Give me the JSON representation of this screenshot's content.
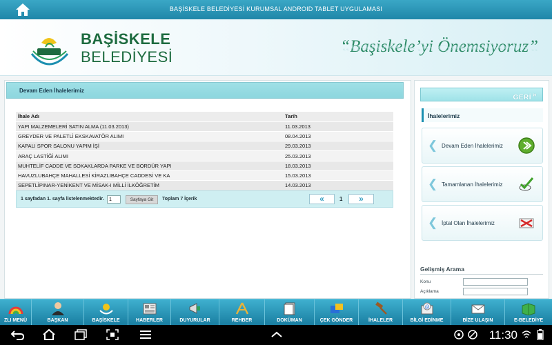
{
  "app_title": "BAŞİSKELE BELEDİYESİ KURUMSAL ANDROID TABLET UYGULAMASI",
  "logo": {
    "line1": "BAŞİSKELE",
    "line2": "BELEDİYESİ",
    "emblem_text": "BAŞİSKELE BELEDİYESİ"
  },
  "slogan": "“Başiskele’yi Önemsiyoruz”",
  "content": {
    "heading": "Devam Eden İhalelerimiz",
    "columns": [
      "İhale Adı",
      "Tarih"
    ],
    "rows": [
      {
        "name": "YAPI MALZEMELERİ SATIN ALMA (11.03.2013)",
        "date": "11.03.2013"
      },
      {
        "name": "GREYDER VE PALETLİ EKSKAVATÖR ALIMI",
        "date": "08.04.2013"
      },
      {
        "name": "KAPALI SPOR SALONU YAPIM İŞİ",
        "date": "29.03.2013"
      },
      {
        "name": "ARAÇ LASTİĞİ ALIMI",
        "date": "25.03.2013"
      },
      {
        "name": "MUHTELİF CADDE VE SOKAKLARDA PARKE VE BORDÜR YAPI",
        "date": "18.03.2013"
      },
      {
        "name": "HAVUZLUBAHÇE MAHALLESİ KİRAZLIBAHÇE CADDESİ VE KA",
        "date": "15.03.2013"
      },
      {
        "name": "SEPETLİPINAR-YENİKENT VE MİSAK-I MİLLİ İLKÖĞRETİM",
        "date": "14.03.2013"
      }
    ],
    "pager": {
      "status": "1 sayfadan 1. sayfa listelenmektedir.",
      "page_input": "1",
      "go_label": "Sayfaya Git",
      "total": "Toplam 7 İçerik",
      "prev": "«",
      "next": "»",
      "current": "1"
    }
  },
  "side": {
    "back_label": "GERİ",
    "section_title": "İhalelerimiz",
    "items": [
      {
        "label": "Devam Eden İhalelerimiz",
        "icon": "green-forward-icon"
      },
      {
        "label": "Tamamlanan İhalelerimiz",
        "icon": "checkmark-icon"
      },
      {
        "label": "İptal Olan İhalelerimiz",
        "icon": "cancel-envelope-icon"
      }
    ],
    "advanced_search": {
      "title": "Gelişmiş Arama",
      "fields": [
        "Konu",
        "Açıklama"
      ]
    }
  },
  "bottom_menu": [
    {
      "label": "ZLI MENÜ",
      "icon": "rainbow-arc-icon"
    },
    {
      "label": "BAŞKAN",
      "icon": "person-icon"
    },
    {
      "label": "BAŞİSKELE",
      "icon": "logo-icon"
    },
    {
      "label": "HABERLER",
      "icon": "newspaper-icon"
    },
    {
      "label": "DUYURULAR",
      "icon": "megaphone-icon"
    },
    {
      "label": "REHBER",
      "icon": "compass-icon"
    },
    {
      "label": "DOKÜMAN",
      "icon": "document-icon"
    },
    {
      "label": "ÇEK GÖNDER",
      "icon": "camera-icon"
    },
    {
      "label": "İHALELER",
      "icon": "gavel-icon"
    },
    {
      "label": "BİLGİ EDİNME",
      "icon": "info-icon"
    },
    {
      "label": "BİZE ULAŞIN",
      "icon": "envelope-icon"
    },
    {
      "label": "E-BELEDİYE",
      "icon": "book-icon"
    }
  ],
  "status_bar": {
    "time": "11:30"
  },
  "colors": {
    "accent": "#1f86a8",
    "brand_green": "#1d6b3f",
    "header_cyan": "#9fe0e6"
  }
}
